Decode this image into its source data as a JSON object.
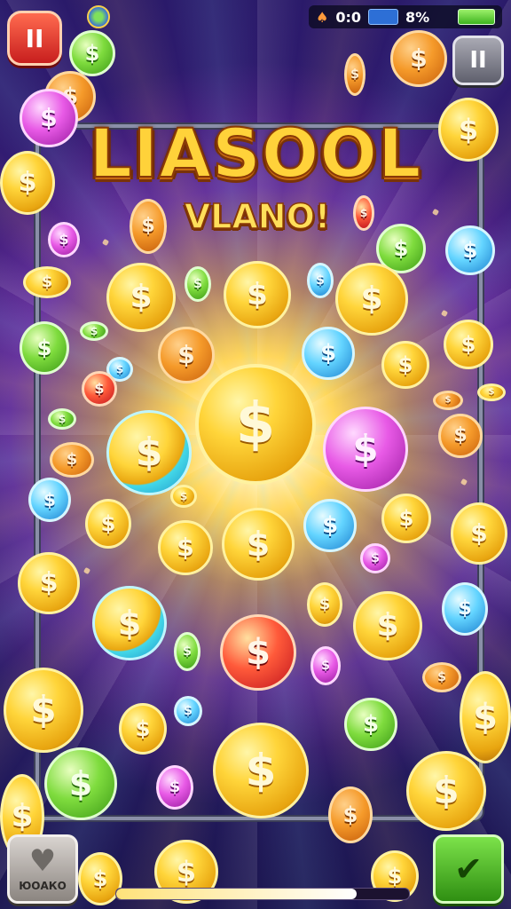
{
  "status_bar": {
    "clock": "0:0",
    "card_label": "",
    "battery_percent_text": "8%"
  },
  "buttons": {
    "pause_left_glyph": "II",
    "pause_right_glyph": "II",
    "bottom_left_label": "ЮОАКО",
    "bottom_left_icon": "heart-icon",
    "bottom_right_icon": "hand-check-icon"
  },
  "title": {
    "main": "LIASOOL",
    "sub": "VLANO!"
  },
  "coin_symbol": "$",
  "progress": {
    "fraction": 0.82
  },
  "colors": {
    "gold": "#ffd53a",
    "green": "#7fdc3e",
    "cyan": "#63d4ff",
    "pink": "#e85ae6",
    "red": "#ff5a3a",
    "orange": "#f59a2a"
  }
}
